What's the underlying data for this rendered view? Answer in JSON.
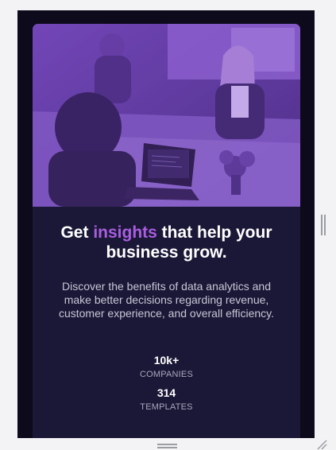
{
  "card": {
    "hero_image_alt": "Colleagues working together in an office with a laptop",
    "headline": {
      "prefix": "Get ",
      "accent": "insights",
      "suffix": " that help your business grow."
    },
    "description": "Discover the benefits of data analytics and make better decisions regarding revenue, customer experience, and overall efficiency.",
    "stats": [
      {
        "value": "10k+",
        "label": "COMPANIES"
      },
      {
        "value": "314",
        "label": "TEMPLATES"
      }
    ]
  },
  "colors": {
    "page_background": "#0d0a1c",
    "card_background": "#1b1837",
    "accent": "#aa5ee0",
    "image_tint": "#8c5ccf"
  }
}
